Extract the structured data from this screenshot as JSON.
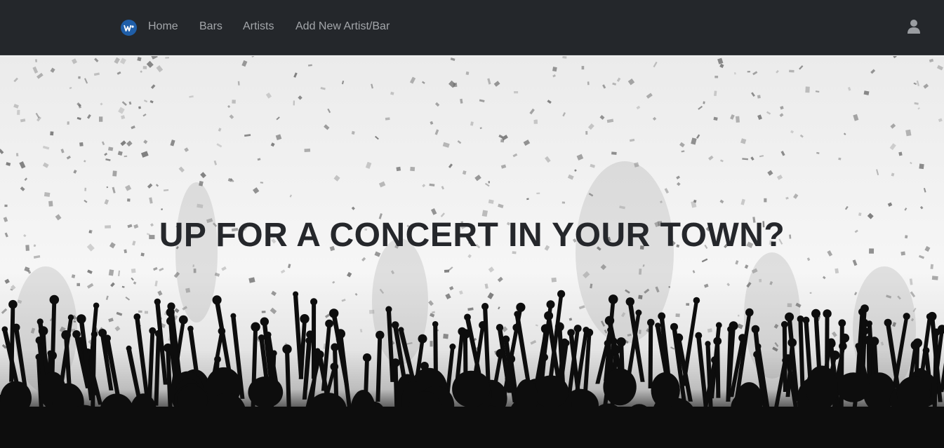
{
  "navbar": {
    "logo_icon": "warner-w-logo-icon",
    "links": [
      {
        "label": "Home"
      },
      {
        "label": "Bars"
      },
      {
        "label": "Artists"
      },
      {
        "label": "Add New Artist/Bar"
      }
    ],
    "user_icon": "user-icon"
  },
  "hero": {
    "title": "UP FOR A CONCERT IN YOUR TOWN?",
    "background": "concert-crowd-confetti-image"
  },
  "colors": {
    "navbar_bg": "#24272b",
    "nav_link": "#a3a6aa",
    "logo_blue": "#1f5ea8",
    "title": "#25272b"
  }
}
